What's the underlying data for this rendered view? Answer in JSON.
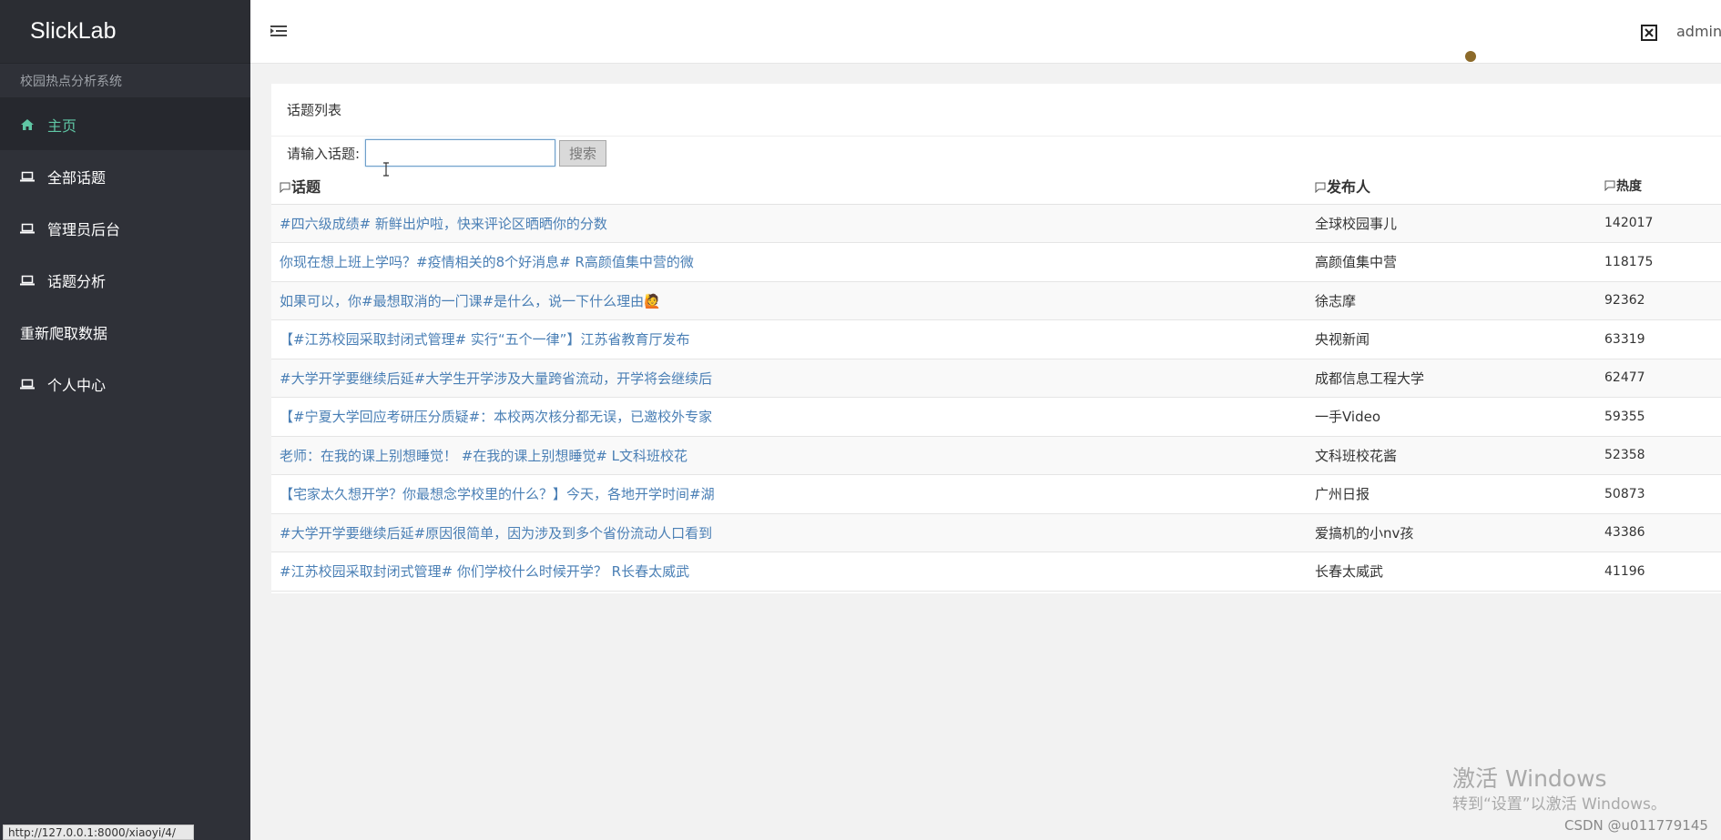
{
  "sidebar": {
    "brand": "SlickLab",
    "subtitle": "校园热点分析系统",
    "items": [
      {
        "label": "主页",
        "icon": "home-icon",
        "active": true
      },
      {
        "label": "全部话题",
        "icon": "laptop-icon"
      },
      {
        "label": "管理员后台",
        "icon": "laptop-icon"
      },
      {
        "label": "话题分析",
        "icon": "laptop-icon"
      },
      {
        "label": "重新爬取数据",
        "icon": ""
      },
      {
        "label": "个人中心",
        "icon": "laptop-icon"
      }
    ],
    "active_color": "#5fc6a4"
  },
  "topbar": {
    "menu_icon": "menu-toggle-icon",
    "fullscreen_icon": "fullscreen-icon",
    "user": "admin"
  },
  "panel": {
    "title": "话题列表",
    "search": {
      "label": "请输入话题:",
      "value": "",
      "button": "搜索"
    },
    "columns": {
      "topic": "话题",
      "author": "发布人",
      "heat": "热度"
    },
    "rows": [
      {
        "topic": "#四六级成绩# 新鲜出炉啦，快来评论区晒晒你的分数",
        "author": "全球校园事儿",
        "heat": "142017"
      },
      {
        "topic": "你现在想上班上学吗？#疫情相关的8个好消息# R高颜值集中营的微",
        "author": "高颜值集中营",
        "heat": "118175"
      },
      {
        "topic": "如果可以，你#最想取消的一门课#是什么，说一下什么理由🙋",
        "author": "徐志摩",
        "heat": "92362"
      },
      {
        "topic": "【#江苏校园采取封闭式管理# 实行“五个一律”】江苏省教育厅发布",
        "author": "央视新闻",
        "heat": "63319"
      },
      {
        "topic": "#大学开学要继续后延#大学生开学涉及大量跨省流动，开学将会继续后",
        "author": "成都信息工程大学",
        "heat": "62477"
      },
      {
        "topic": "【#宁夏大学回应考研压分质疑#：本校两次核分都无误，已邀校外专家",
        "author": "一手Video",
        "heat": "59355"
      },
      {
        "topic": "老师：在我的课上别想睡觉！ #在我的课上别想睡觉# L文科班校花",
        "author": "文科班校花酱",
        "heat": "52358"
      },
      {
        "topic": "【宅家太久想开学？你最想念学校里的什么？】今天，各地开学时间#湖",
        "author": "广州日报",
        "heat": "50873"
      },
      {
        "topic": "#大学开学要继续后延#原因很简单，因为涉及到多个省份流动人口看到",
        "author": "爱搞机的小nv孩",
        "heat": "43386"
      },
      {
        "topic": "#江苏校园采取封闭式管理# 你们学校什么时候开学？ R长春太威武",
        "author": "长春太威武",
        "heat": "41196"
      }
    ],
    "link_color": "#4a7fb5"
  },
  "status_url": "http://127.0.0.1:8000/xiaoyi/4/",
  "watermark": {
    "title": "激活 Windows",
    "subtitle": "转到“设置”以激活 Windows。",
    "credit": "CSDN @u011779145"
  }
}
